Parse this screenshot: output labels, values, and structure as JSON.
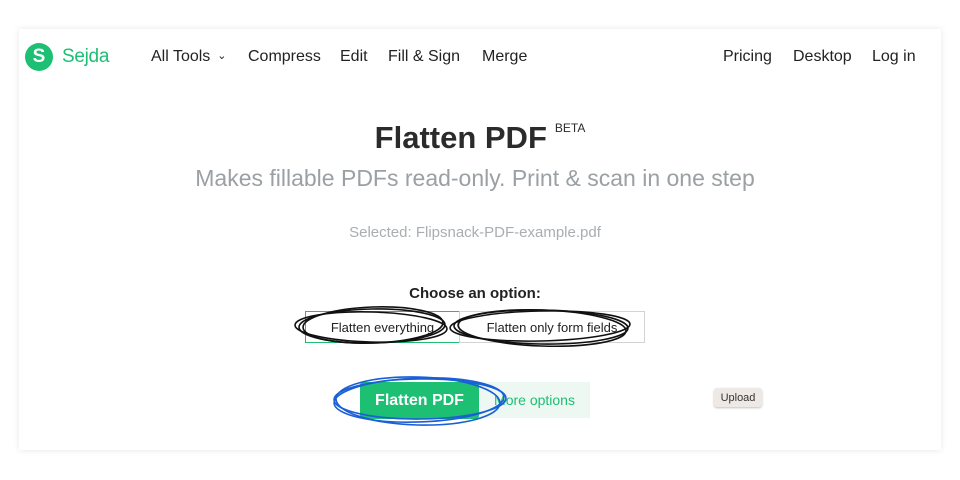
{
  "nav": {
    "logo_letter": "S",
    "logo_text": "Sejda",
    "left_items": [
      "All Tools",
      "Compress",
      "Edit",
      "Fill & Sign",
      "Merge"
    ],
    "right_items": [
      "Pricing",
      "Desktop",
      "Log in"
    ]
  },
  "main": {
    "title": "Flatten PDF",
    "badge": "BETA",
    "subtitle": "Makes fillable PDFs read-only. Print & scan in one step",
    "selected_text": "Selected: Flipsnack-PDF-example.pdf",
    "choose_label": "Choose an option:",
    "options": [
      "Flatten everything",
      "Flatten only form fields"
    ],
    "selected_option": "Flatten everything",
    "primary_button": "Flatten PDF",
    "more_options": "More options",
    "upload_label": "Upload"
  },
  "colors": {
    "brand": "#1dbf73",
    "annotation_black": "#111111",
    "annotation_blue": "#1a5fd6"
  }
}
